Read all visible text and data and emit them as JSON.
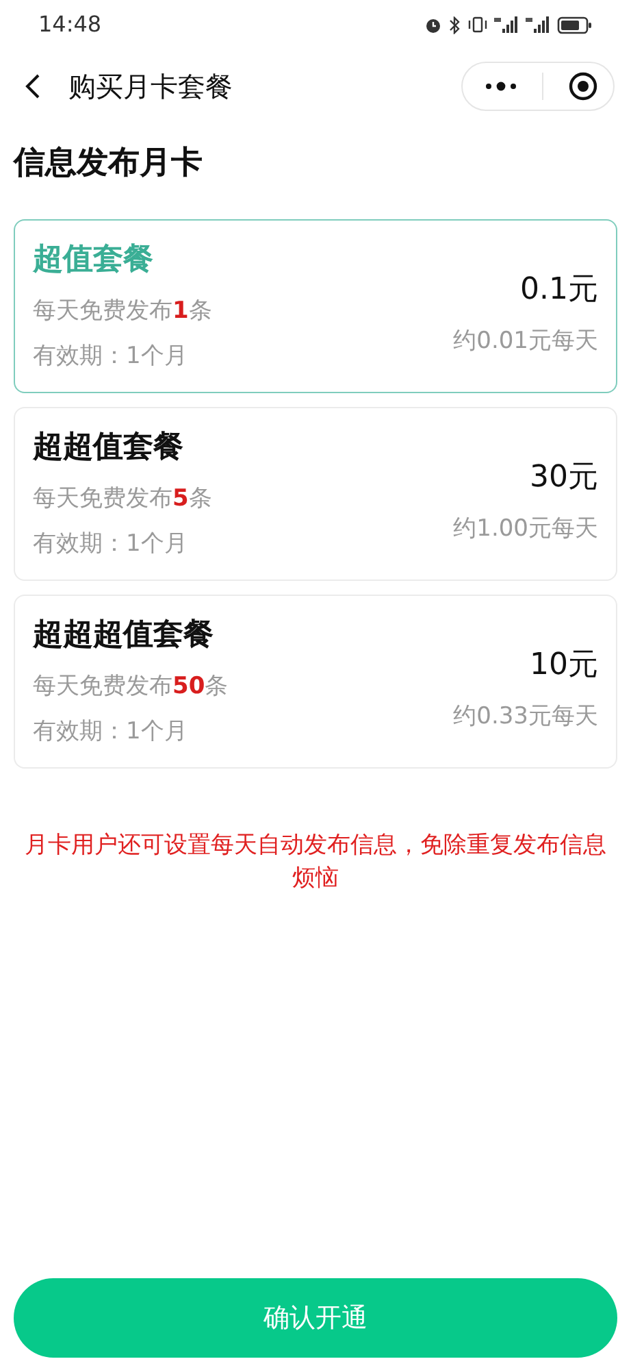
{
  "status_bar": {
    "time": "14:48"
  },
  "nav": {
    "title": "购买月卡套餐"
  },
  "heading": "信息发布月卡",
  "plans": [
    {
      "name": "超值套餐",
      "quota_prefix": "每天免费发布",
      "quota_count": "1",
      "quota_suffix": "条",
      "validity": "有效期：1个月",
      "price": "0.1元",
      "per_day": "约0.01元每天",
      "selected": true
    },
    {
      "name": "超超值套餐",
      "quota_prefix": "每天免费发布",
      "quota_count": "5",
      "quota_suffix": "条",
      "validity": "有效期：1个月",
      "price": "30元",
      "per_day": "约1.00元每天",
      "selected": false
    },
    {
      "name": "超超超值套餐",
      "quota_prefix": "每天免费发布",
      "quota_count": "50",
      "quota_suffix": "条",
      "validity": "有效期：1个月",
      "price": "10元",
      "per_day": "约0.33元每天",
      "selected": false
    }
  ],
  "notice": "月卡用户还可设置每天自动发布信息，免除重复发布信息烦恼",
  "confirm_button": "确认开通"
}
